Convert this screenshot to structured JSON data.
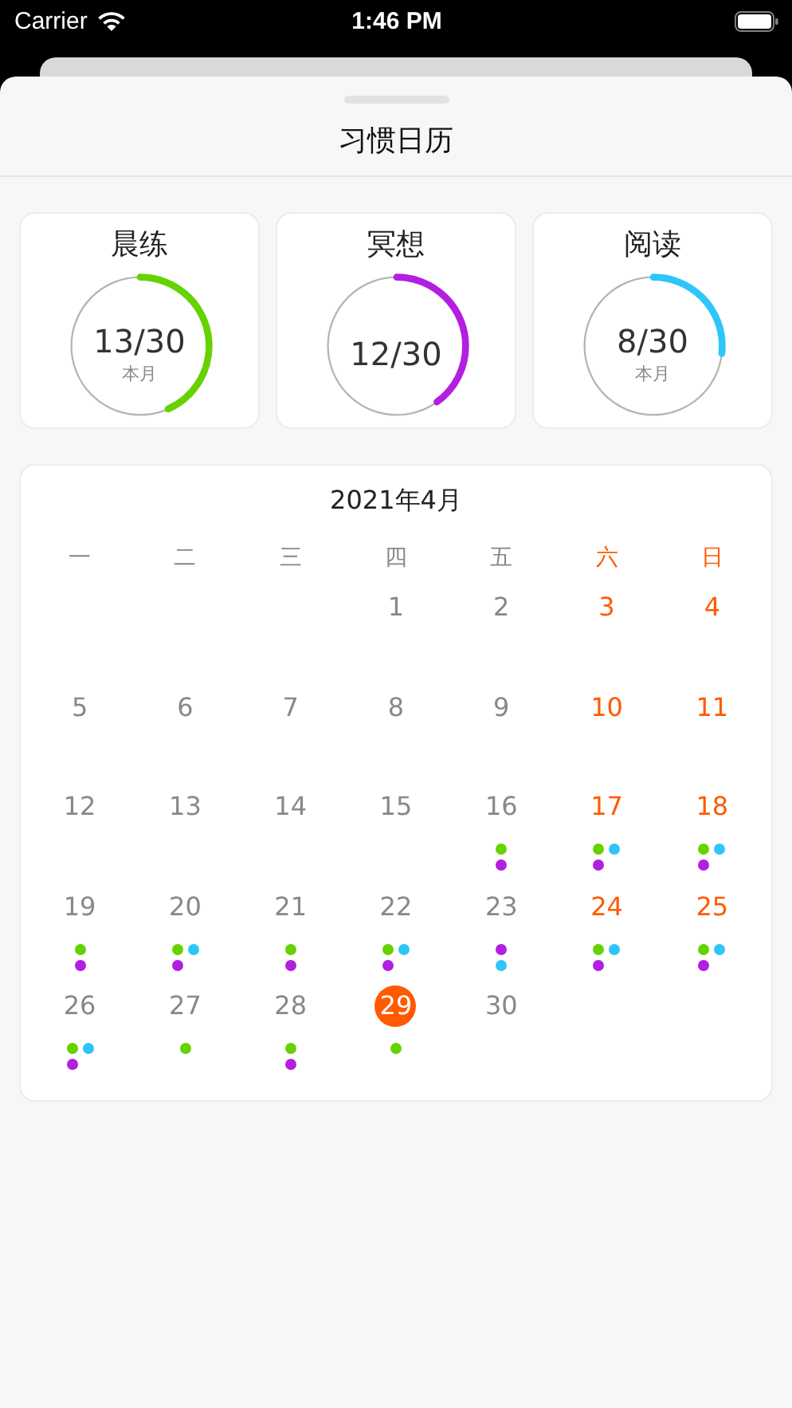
{
  "status_bar": {
    "carrier": "Carrier",
    "time": "1:46 PM"
  },
  "title": "习惯日历",
  "habits": [
    {
      "name": "晨练",
      "count": "13/30",
      "sub": "本月",
      "level": 0.433,
      "color": "#66d200"
    },
    {
      "name": "冥想",
      "count": "12/30",
      "level": 0.4,
      "color": "#b31fe0"
    },
    {
      "name": "阅读",
      "count": "8/30",
      "sub": "本月",
      "level": 0.267,
      "color": "#2ec6fa"
    }
  ],
  "calendar": {
    "month": "2021年4月",
    "weekdays": [
      {
        "label": "一",
        "weekend": false
      },
      {
        "label": "二",
        "weekend": false
      },
      {
        "label": "三",
        "weekend": false
      },
      {
        "label": "四",
        "weekend": false
      },
      {
        "label": "五",
        "weekend": false
      },
      {
        "label": "六",
        "weekend": true
      },
      {
        "label": "日",
        "weekend": true
      }
    ],
    "weeks": [
      [
        {
          "day": "1",
          "weekend": false,
          "selected": false
        },
        {
          "day": "2",
          "weekend": false,
          "selected": false
        },
        {
          "day": "3",
          "weekend": true,
          "selected": false
        },
        {
          "day": "4",
          "weekend": true,
          "selected": false
        }
      ],
      [
        {
          "day": "5",
          "weekend": false,
          "selected": false
        },
        {
          "day": "6",
          "weekend": false,
          "selected": false
        },
        {
          "day": "7",
          "weekend": false,
          "selected": false
        },
        {
          "day": "8",
          "weekend": false,
          "selected": false
        },
        {
          "day": "9",
          "weekend": false,
          "selected": false
        },
        {
          "day": "10",
          "weekend": true,
          "selected": false
        },
        {
          "day": "11",
          "weekend": true,
          "selected": false
        }
      ],
      [
        {
          "day": "12",
          "weekend": false,
          "selected": false
        },
        {
          "day": "13",
          "weekend": false,
          "selected": false
        },
        {
          "day": "14",
          "weekend": false,
          "selected": false
        },
        {
          "day": "15",
          "weekend": false,
          "selected": false
        },
        {
          "day": "16",
          "weekend": false,
          "selected": false,
          "dots": [
            {
              "color": "#66d200"
            },
            {
              "color": "#b31fe0"
            }
          ]
        },
        {
          "day": "17",
          "weekend": true,
          "selected": false,
          "dots": [
            {
              "color": "#66d200"
            },
            {
              "color": "#2ec6fa"
            },
            {
              "color": "#b31fe0"
            }
          ]
        },
        {
          "day": "18",
          "weekend": true,
          "selected": false,
          "dots": [
            {
              "color": "#66d200"
            },
            {
              "color": "#2ec6fa"
            },
            {
              "color": "#b31fe0"
            }
          ]
        }
      ],
      [
        {
          "day": "19",
          "weekend": false,
          "selected": false,
          "dots": [
            {
              "color": "#66d200"
            },
            {
              "color": "#b31fe0"
            }
          ]
        },
        {
          "day": "20",
          "weekend": false,
          "selected": false,
          "dots": [
            {
              "color": "#66d200"
            },
            {
              "color": "#2ec6fa"
            },
            {
              "color": "#b31fe0"
            }
          ]
        },
        {
          "day": "21",
          "weekend": false,
          "selected": false,
          "dots": [
            {
              "color": "#66d200"
            },
            {
              "color": "#b31fe0"
            }
          ]
        },
        {
          "day": "22",
          "weekend": false,
          "selected": false,
          "dots": [
            {
              "color": "#66d200"
            },
            {
              "color": "#2ec6fa"
            },
            {
              "color": "#b31fe0"
            }
          ]
        },
        {
          "day": "23",
          "weekend": false,
          "selected": false,
          "dots": [
            {
              "color": "#b31fe0"
            },
            {
              "color": "#2ec6fa"
            }
          ]
        },
        {
          "day": "24",
          "weekend": true,
          "selected": false,
          "dots": [
            {
              "color": "#66d200"
            },
            {
              "color": "#2ec6fa"
            },
            {
              "color": "#b31fe0"
            }
          ]
        },
        {
          "day": "25",
          "weekend": true,
          "selected": false,
          "dots": [
            {
              "color": "#66d200"
            },
            {
              "color": "#2ec6fa"
            },
            {
              "color": "#b31fe0"
            }
          ]
        }
      ],
      [
        {
          "day": "26",
          "weekend": false,
          "selected": false,
          "dots": [
            {
              "color": "#66d200"
            },
            {
              "color": "#2ec6fa"
            },
            {
              "color": "#b31fe0"
            }
          ]
        },
        {
          "day": "27",
          "weekend": false,
          "selected": false,
          "dots": [
            {
              "color": "#66d200"
            }
          ]
        },
        {
          "day": "28",
          "weekend": false,
          "selected": false,
          "dots": [
            {
              "color": "#66d200"
            },
            {
              "color": "#b31fe0"
            }
          ]
        },
        {
          "day": "29",
          "weekend": false,
          "selected": true,
          "dots": [
            {
              "color": "#66d200"
            }
          ]
        },
        {
          "day": "30",
          "weekend": false,
          "selected": false
        }
      ]
    ]
  }
}
